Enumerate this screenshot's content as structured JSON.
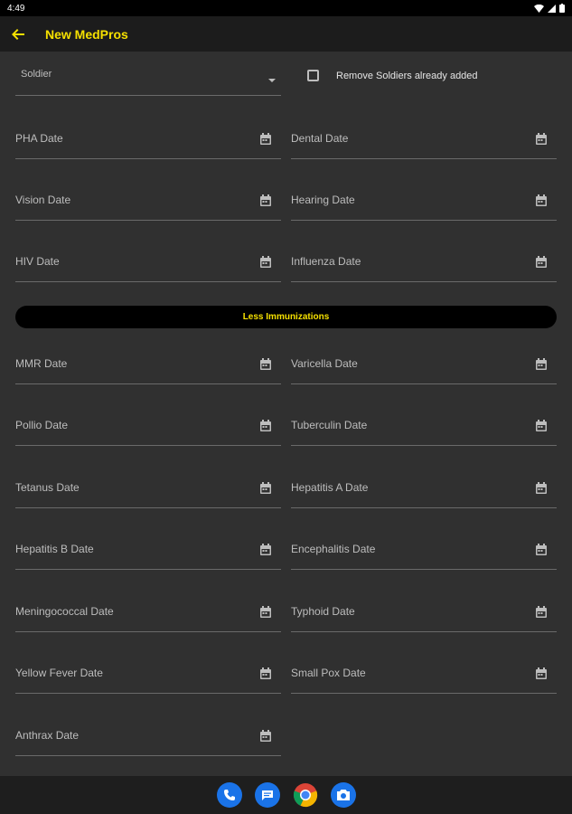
{
  "status_bar": {
    "time": "4:49"
  },
  "app_bar": {
    "title": "New MedPros"
  },
  "soldier_select": {
    "label": "Soldier"
  },
  "remove_checkbox": {
    "label": "Remove Soldiers already added",
    "checked": false
  },
  "immunizations_button": {
    "label": "Less Immunizations"
  },
  "fields": {
    "pha": "PHA Date",
    "dental": "Dental Date",
    "vision": "Vision Date",
    "hearing": "Hearing Date",
    "hiv": "HIV Date",
    "influenza": "Influenza Date",
    "mmr": "MMR Date",
    "varicella": "Varicella Date",
    "polio": "Pollio Date",
    "tuberculin": "Tuberculin Date",
    "tetanus": "Tetanus Date",
    "hepatitis_a": "Hepatitis A Date",
    "hepatitis_b": "Hepatitis B Date",
    "encephalitis": "Encephalitis Date",
    "meningococcal": "Meningococcal Date",
    "typhoid": "Typhoid Date",
    "yellow_fever": "Yellow Fever Date",
    "small_pox": "Small Pox Date",
    "anthrax": "Anthrax Date"
  },
  "dock": {
    "icons": [
      "phone-icon",
      "messages-icon",
      "chrome-icon",
      "camera-icon"
    ]
  },
  "colors": {
    "accent": "#f5e000",
    "background": "#303030",
    "app_bar": "#1c1c1c"
  }
}
